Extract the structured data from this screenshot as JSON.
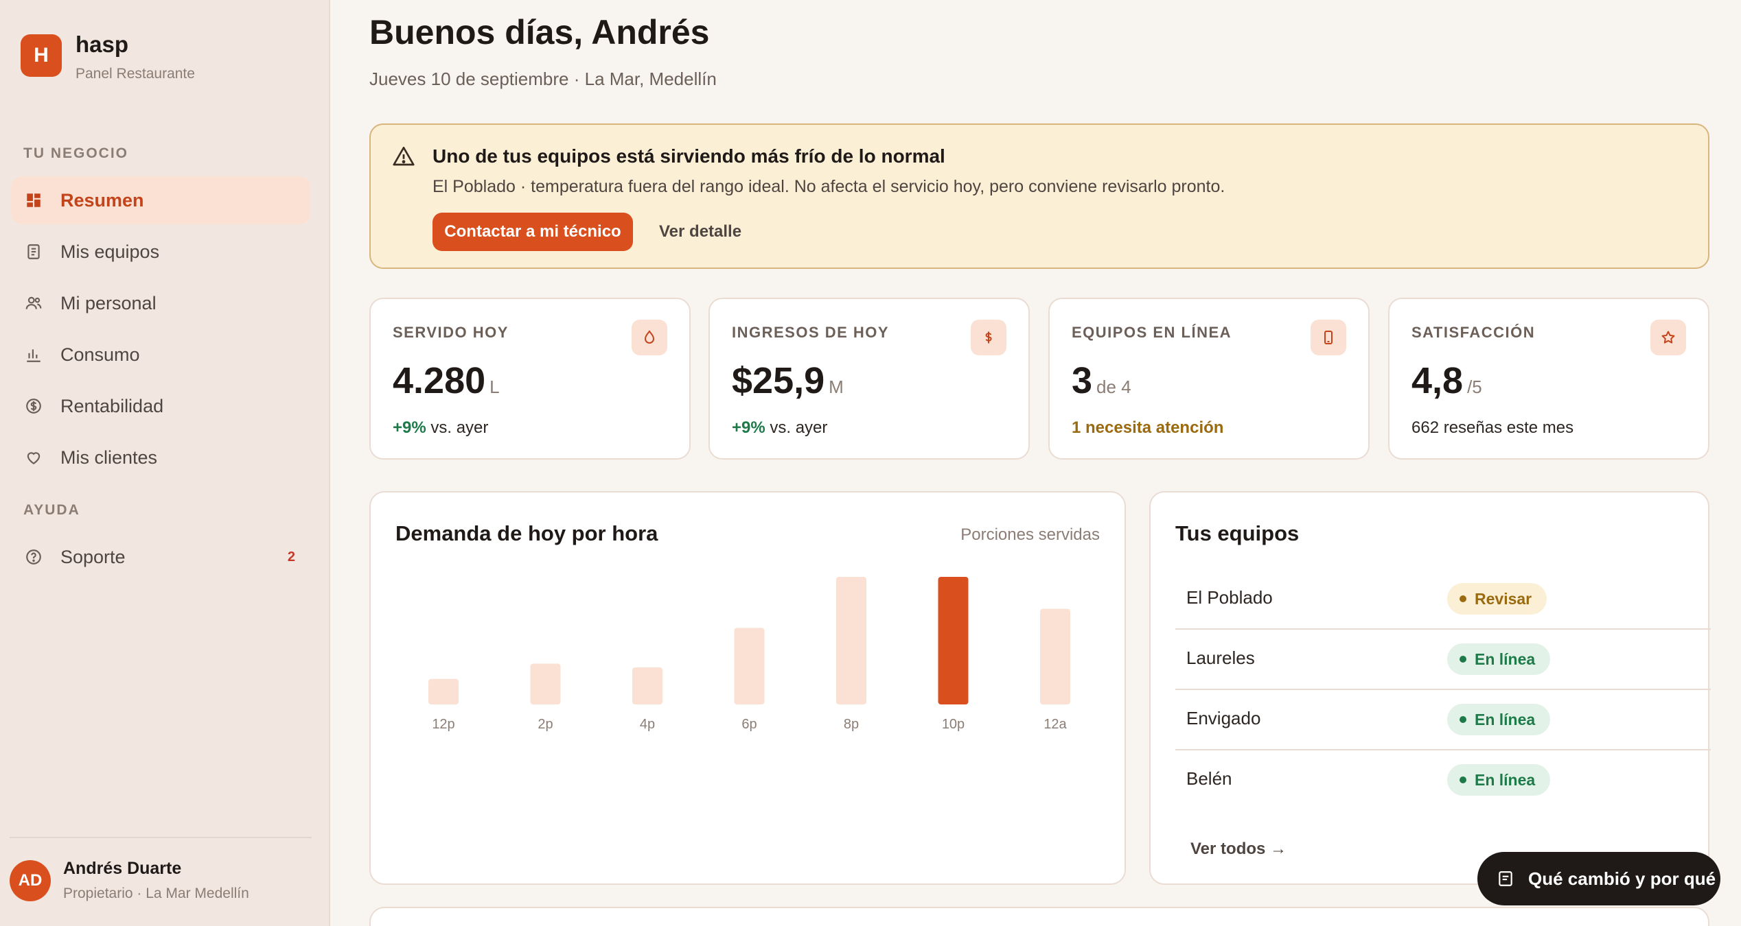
{
  "brand": {
    "logo_letter": "H",
    "name": "hasp",
    "subtitle": "Panel Restaurante",
    "accent": "#d94f1e"
  },
  "sidebar": {
    "section_business": "TU NEGOCIO",
    "section_help": "AYUDA",
    "items": [
      {
        "label": "Resumen",
        "icon": "grid-icon",
        "active": true
      },
      {
        "label": "Mis equipos",
        "icon": "document-icon"
      },
      {
        "label": "Mi personal",
        "icon": "users-icon"
      },
      {
        "label": "Consumo",
        "icon": "bar-chart-icon"
      },
      {
        "label": "Rentabilidad",
        "icon": "dollar-circle-icon"
      },
      {
        "label": "Mis clientes",
        "icon": "heart-icon"
      }
    ],
    "support": {
      "label": "Soporte",
      "icon": "help-circle-icon",
      "badge": "2"
    }
  },
  "user": {
    "initials": "AD",
    "name": "Andrés Duarte",
    "role": "Propietario · La Mar Medellín"
  },
  "header": {
    "greeting": "Buenos días, Andrés",
    "date_line": "Jueves 10 de septiembre · La Mar, Medellín"
  },
  "alert": {
    "icon": "warning-icon",
    "title": "Uno de tus equipos está sirviendo más frío de lo normal",
    "description": "El Poblado · temperatura fuera del rango ideal. No afecta el servicio hoy, pero conviene revisarlo pronto.",
    "primary_label": "Contactar a mi técnico",
    "secondary_label": "Ver detalle",
    "bg_color": "#fbefd6"
  },
  "kpis": [
    {
      "label": "SERVIDO HOY",
      "value": "4.280",
      "unit": "L",
      "delta": "+9%",
      "foot": " vs. ayer",
      "icon": "drop-icon"
    },
    {
      "label": "INGRESOS DE HOY",
      "value": "$25,9",
      "unit": "M",
      "delta": "+9%",
      "foot": " vs. ayer",
      "icon": "dollar-icon"
    },
    {
      "label": "EQUIPOS EN LÍNEA",
      "value": "3",
      "unit": "de 4",
      "warn": "1 necesita atención",
      "icon": "device-icon"
    },
    {
      "label": "SATISFACCIÓN",
      "value": "4,8",
      "unit": "/5",
      "foot": "662 reseñas este mes",
      "icon": "star-icon"
    }
  ],
  "demand": {
    "title": "Demanda de hoy por hora",
    "subtitle": "Porciones servidas"
  },
  "chart_data": {
    "type": "bar",
    "title": "Demanda de hoy por hora",
    "categories": [
      "12p",
      "2p",
      "4p",
      "6p",
      "8p",
      "10p",
      "12a"
    ],
    "values": [
      20,
      32,
      29,
      60,
      100,
      100,
      75
    ],
    "highlight_index": 5,
    "ylim": [
      0,
      100
    ],
    "grid": false,
    "bar_color": "#fbe1d4",
    "highlight_color": "#d94f1e"
  },
  "equipment": {
    "title": "Tus equipos",
    "rows": [
      {
        "name": "El Poblado",
        "status": "Revisar",
        "kind": "warn"
      },
      {
        "name": "Laureles",
        "status": "En línea",
        "kind": "ok"
      },
      {
        "name": "Envigado",
        "status": "En línea",
        "kind": "ok"
      },
      {
        "name": "Belén",
        "status": "En línea",
        "kind": "ok"
      }
    ],
    "see_all": "Ver todos →"
  },
  "fab": {
    "label": "Qué cambió y por qué",
    "icon": "notes-icon"
  }
}
